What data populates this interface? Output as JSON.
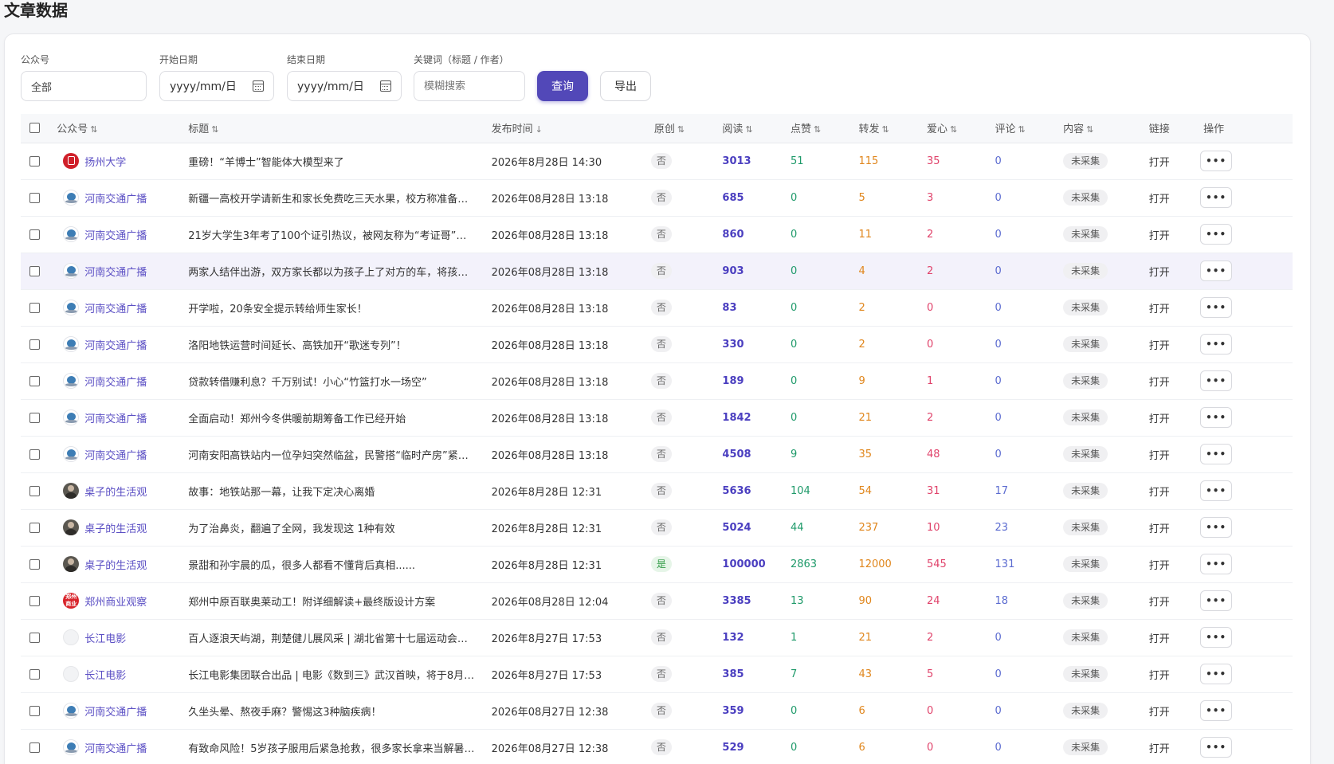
{
  "page": {
    "title": "文章数据"
  },
  "filters": {
    "account_label": "公众号",
    "account_value": "全部",
    "start_label": "开始日期",
    "start_value": "yyyy/mm/日",
    "end_label": "结束日期",
    "end_value": "yyyy/mm/日",
    "keyword_label": "关键词（标题 / 作者）",
    "keyword_placeholder": "模糊搜索",
    "query_label": "查询",
    "export_label": "导出"
  },
  "table": {
    "headers": {
      "account": "公众号",
      "title": "标题",
      "time": "发布时间",
      "original": "原创",
      "read": "阅读",
      "like": "点赞",
      "forward": "转发",
      "love": "爱心",
      "comment": "评论",
      "content": "内容",
      "link": "链接",
      "action": "操作"
    },
    "sort_icon": "⇅",
    "sort_desc_icon": "↓",
    "more_icon": "•••",
    "rows": [
      {
        "account": "扬州大学",
        "avatar": "red-seal",
        "title": "重磅！“羊博士”智能体大模型来了",
        "time": "2026年8月28日 14:30",
        "original": "否",
        "read": "3013",
        "like": "51",
        "forward": "115",
        "love": "35",
        "comment": "0",
        "content": "未采集",
        "link": "打开"
      },
      {
        "account": "河南交通广播",
        "avatar": "globe",
        "title": "新疆一高校开学请新生和家长免费吃三天水果，校方称准备超2...",
        "time": "2026年08月28日 13:18",
        "original": "否",
        "read": "685",
        "like": "0",
        "forward": "5",
        "love": "3",
        "comment": "0",
        "content": "未采集",
        "link": "打开"
      },
      {
        "account": "河南交通广播",
        "avatar": "globe",
        "title": "21岁大学生3年考了100个证引热议，被网友称为“考证哥”，...",
        "time": "2026年08月28日 13:18",
        "original": "否",
        "read": "860",
        "like": "0",
        "forward": "11",
        "love": "2",
        "comment": "0",
        "content": "未采集",
        "link": "打开"
      },
      {
        "account": "河南交通广播",
        "avatar": "globe",
        "title": "两家人结伴出游，双方家长都以为孩子上了对方的车，将孩子“...",
        "time": "2026年08月28日 13:18",
        "original": "否",
        "read": "903",
        "like": "0",
        "forward": "4",
        "love": "2",
        "comment": "0",
        "content": "未采集",
        "link": "打开"
      },
      {
        "account": "河南交通广播",
        "avatar": "globe",
        "title": "开学啦，20条安全提示转给师生家长！",
        "time": "2026年08月28日 13:18",
        "original": "否",
        "read": "83",
        "like": "0",
        "forward": "2",
        "love": "0",
        "comment": "0",
        "content": "未采集",
        "link": "打开"
      },
      {
        "account": "河南交通广播",
        "avatar": "globe",
        "title": "洛阳地铁运营时间延长、高铁加开“歌迷专列”！",
        "time": "2026年08月28日 13:18",
        "original": "否",
        "read": "330",
        "like": "0",
        "forward": "2",
        "love": "0",
        "comment": "0",
        "content": "未采集",
        "link": "打开"
      },
      {
        "account": "河南交通广播",
        "avatar": "globe",
        "title": "贷款转借赚利息？千万别试！小心“竹篮打水一场空”",
        "time": "2026年08月28日 13:18",
        "original": "否",
        "read": "189",
        "like": "0",
        "forward": "9",
        "love": "1",
        "comment": "0",
        "content": "未采集",
        "link": "打开"
      },
      {
        "account": "河南交通广播",
        "avatar": "globe",
        "title": "全面启动！郑州今冬供暖前期筹备工作已经开始",
        "time": "2026年08月28日 13:18",
        "original": "否",
        "read": "1842",
        "like": "0",
        "forward": "21",
        "love": "2",
        "comment": "0",
        "content": "未采集",
        "link": "打开"
      },
      {
        "account": "河南交通广播",
        "avatar": "globe",
        "title": "河南安阳高铁站内一位孕妇突然临盆，民警搭“临时产房”紧急...",
        "time": "2026年08月28日 13:18",
        "original": "否",
        "read": "4508",
        "like": "9",
        "forward": "35",
        "love": "48",
        "comment": "0",
        "content": "未采集",
        "link": "打开"
      },
      {
        "account": "桌子的生活观",
        "avatar": "person",
        "title": "故事：地铁站那一幕，让我下定决心离婚",
        "time": "2026年8月28日 12:31",
        "original": "否",
        "read": "5636",
        "like": "104",
        "forward": "54",
        "love": "31",
        "comment": "17",
        "content": "未采集",
        "link": "打开"
      },
      {
        "account": "桌子的生活观",
        "avatar": "person",
        "title": "为了治鼻炎，翻遍了全网，我发现这 1种有效",
        "time": "2026年8月28日 12:31",
        "original": "否",
        "read": "5024",
        "like": "44",
        "forward": "237",
        "love": "10",
        "comment": "23",
        "content": "未采集",
        "link": "打开"
      },
      {
        "account": "桌子的生活观",
        "avatar": "person",
        "title": "景甜和孙宇晨的瓜，很多人都看不懂背后真相......",
        "time": "2026年8月28日 12:31",
        "original": "是",
        "read": "100000",
        "like": "2863",
        "forward": "12000",
        "love": "545",
        "comment": "131",
        "content": "未采集",
        "link": "打开"
      },
      {
        "account": "郑州商业观察",
        "avatar": "zz",
        "title": "郑州中原百联奥莱动工！附详细解读+最终版设计方案",
        "time": "2026年08月28日 12:04",
        "original": "否",
        "read": "3385",
        "like": "13",
        "forward": "90",
        "love": "24",
        "comment": "18",
        "content": "未采集",
        "link": "打开"
      },
      {
        "account": "长江电影",
        "avatar": "blank",
        "title": "百人逐浪天屿湖，荆楚健儿展风采 | 湖北省第十七届运动会群众...",
        "time": "2026年8月27日 17:53",
        "original": "否",
        "read": "132",
        "like": "1",
        "forward": "21",
        "love": "2",
        "comment": "0",
        "content": "未采集",
        "link": "打开"
      },
      {
        "account": "长江电影",
        "avatar": "blank",
        "title": "长江电影集团联合出品 | 电影《数到三》武汉首映，将于8月28...",
        "time": "2026年8月27日 17:53",
        "original": "否",
        "read": "385",
        "like": "7",
        "forward": "43",
        "love": "5",
        "comment": "0",
        "content": "未采集",
        "link": "打开"
      },
      {
        "account": "河南交通广播",
        "avatar": "globe",
        "title": "久坐头晕、熬夜手麻？警惕这3种脑疾病！",
        "time": "2026年08月27日 12:38",
        "original": "否",
        "read": "359",
        "like": "0",
        "forward": "6",
        "love": "0",
        "comment": "0",
        "content": "未采集",
        "link": "打开"
      },
      {
        "account": "河南交通广播",
        "avatar": "globe",
        "title": "有致命风险！5岁孩子服用后紧急抢救，很多家长拿来当解暑药...",
        "time": "2026年08月27日 12:38",
        "original": "否",
        "read": "529",
        "like": "0",
        "forward": "6",
        "love": "0",
        "comment": "0",
        "content": "未采集",
        "link": "打开"
      }
    ]
  }
}
